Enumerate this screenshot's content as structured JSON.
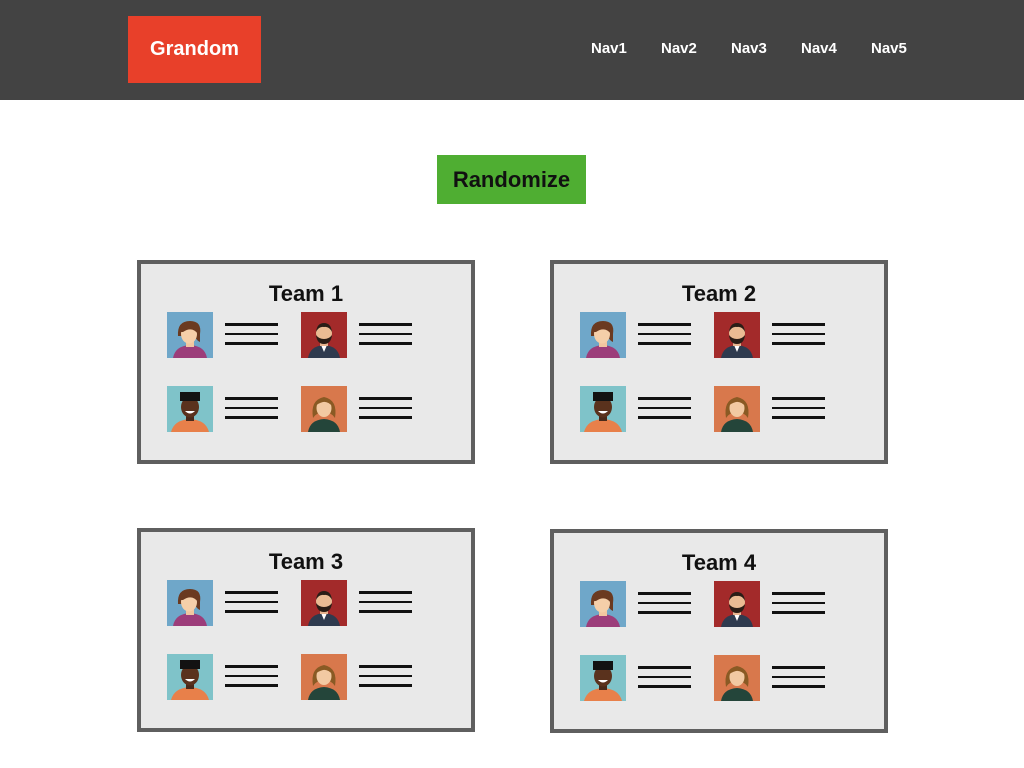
{
  "header": {
    "logo": "Grandom",
    "nav": [
      "Nav1",
      "Nav2",
      "Nav3",
      "Nav4",
      "Nav5"
    ]
  },
  "randomize_label": "Randomize",
  "teams": [
    {
      "title": "Team 1",
      "members": [
        "avatar-woman-blue-bg-icon",
        "avatar-man-bearded-red-bg-icon",
        "avatar-man-dark-skin-teal-bg-icon",
        "avatar-woman-orange-bg-icon"
      ]
    },
    {
      "title": "Team 2",
      "members": [
        "avatar-woman-blue-bg-icon",
        "avatar-man-bearded-red-bg-icon",
        "avatar-man-dark-skin-teal-bg-icon",
        "avatar-woman-orange-bg-icon"
      ]
    },
    {
      "title": "Team 3",
      "members": [
        "avatar-woman-blue-bg-icon",
        "avatar-man-bearded-red-bg-icon",
        "avatar-man-dark-skin-teal-bg-icon",
        "avatar-woman-orange-bg-icon"
      ]
    },
    {
      "title": "Team 4",
      "members": [
        "avatar-woman-blue-bg-icon",
        "avatar-man-bearded-red-bg-icon",
        "avatar-man-dark-skin-teal-bg-icon",
        "avatar-woman-orange-bg-icon"
      ]
    }
  ],
  "colors": {
    "header_bg": "#434343",
    "logo_bg": "#e8402a",
    "randomize_bg": "#4fae32",
    "card_bg": "#e9e9e9",
    "card_border": "#5f5f5f"
  }
}
